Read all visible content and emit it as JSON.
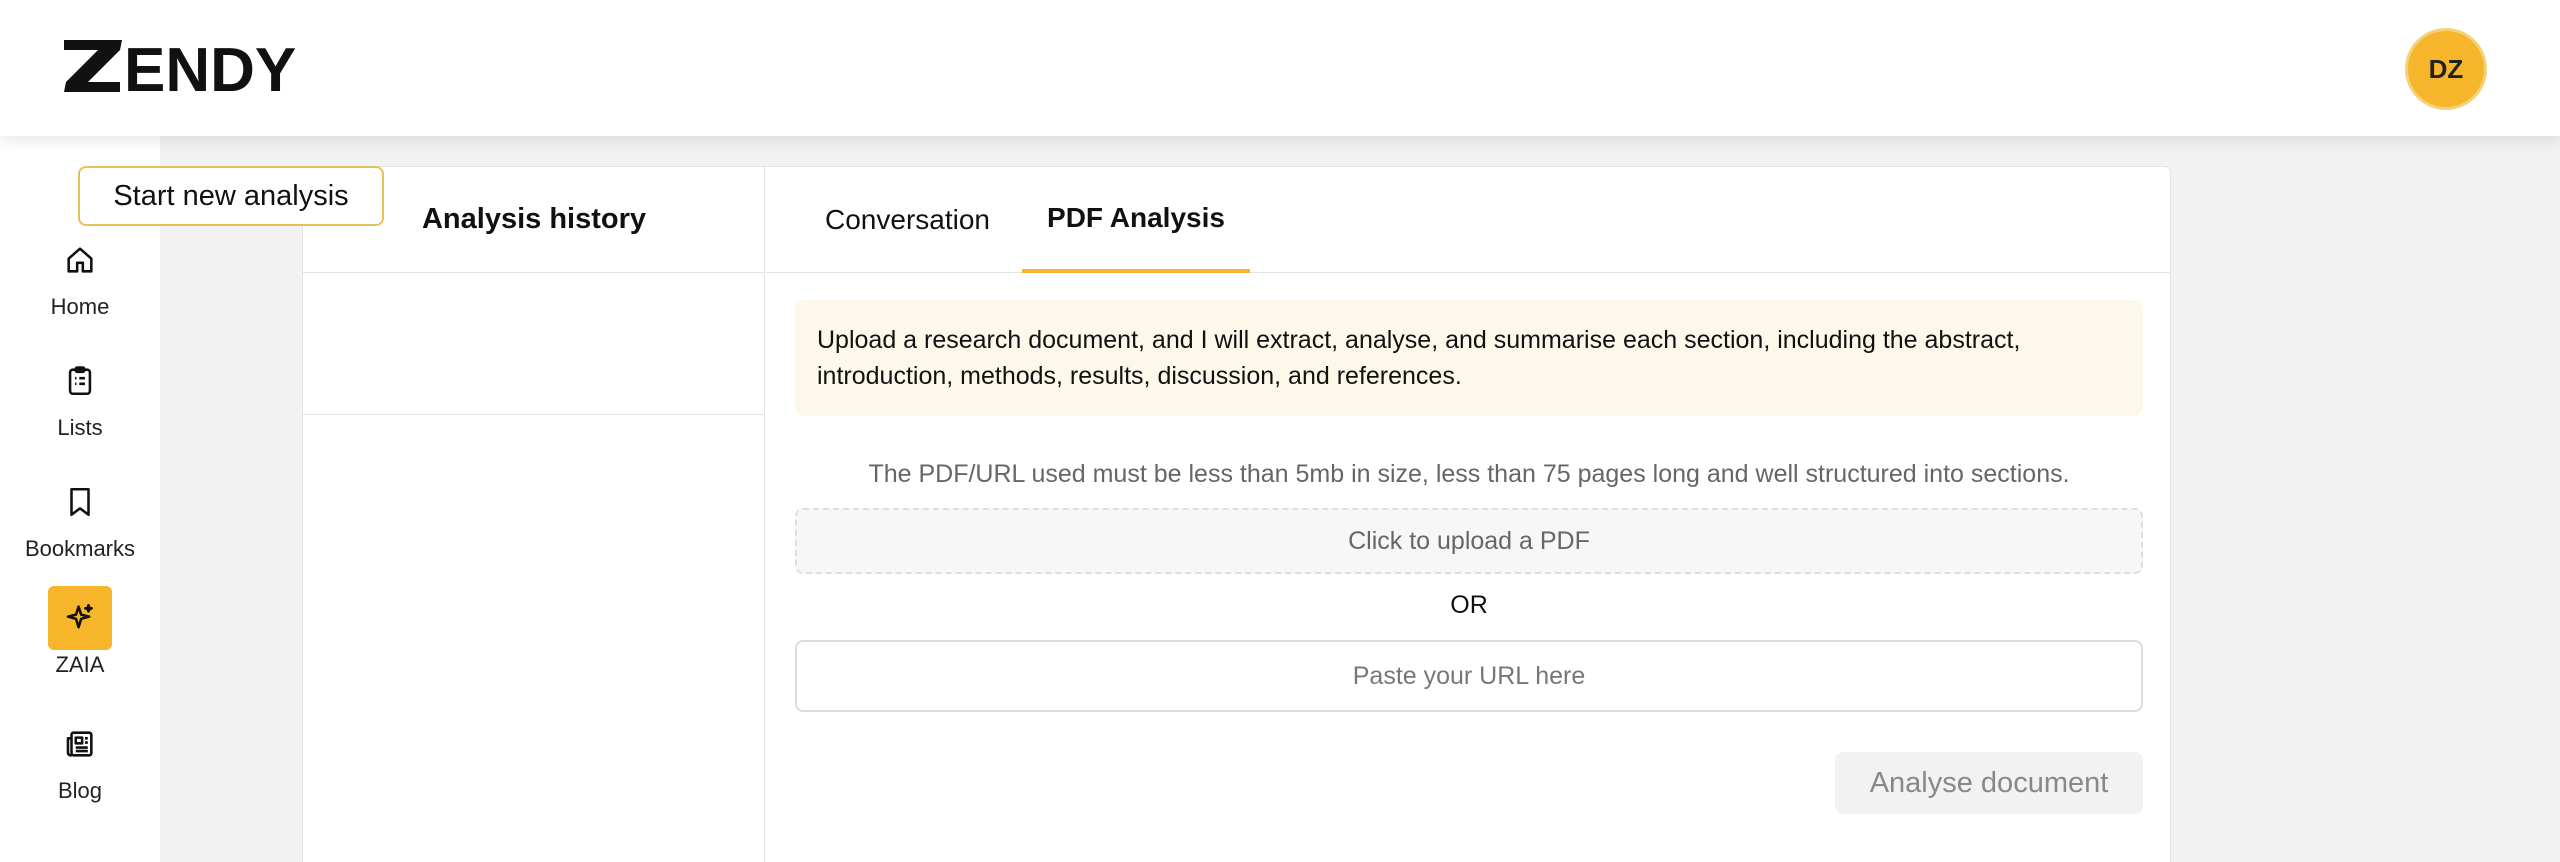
{
  "brand": {
    "name": "ZENDY",
    "accent": "#f7b52c"
  },
  "user": {
    "initials": "DZ"
  },
  "nav": {
    "items": [
      {
        "label": "Home",
        "icon": "home-icon"
      },
      {
        "label": "Lists",
        "icon": "clipboard-icon"
      },
      {
        "label": "Bookmarks",
        "icon": "bookmark-icon"
      },
      {
        "label": "ZAIA",
        "icon": "sparkle-icon",
        "active": true
      },
      {
        "label": "Blog",
        "icon": "newspaper-icon"
      }
    ]
  },
  "history": {
    "title": "Analysis history",
    "start_label": "Start new analysis"
  },
  "tabs": [
    {
      "label": "Conversation",
      "active": false
    },
    {
      "label": "PDF Analysis",
      "active": true
    }
  ],
  "analysis": {
    "notice": "Upload a research document, and I will extract, analyse, and summarise each section, including the abstract, introduction, methods, results, discussion, and references.",
    "limits": "The PDF/URL used must be less than 5mb in size, less than 75 pages long and well structured into sections.",
    "upload_label": "Click to upload a PDF",
    "or_label": "OR",
    "url_placeholder": "Paste your URL here",
    "analyse_label": "Analyse document"
  }
}
